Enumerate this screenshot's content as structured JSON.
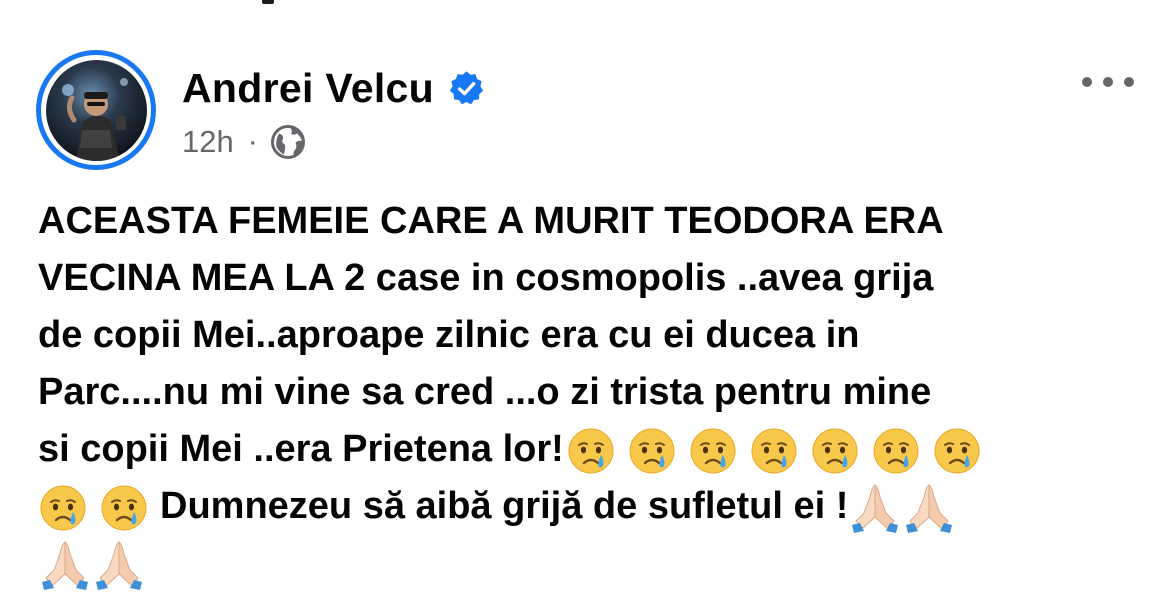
{
  "post": {
    "author": {
      "name": "Andrei Velcu",
      "verified_icon": "verified-badge-icon",
      "avatar_icon": "profile-photo"
    },
    "meta": {
      "time": "12h",
      "separator": "·",
      "audience_icon": "globe-public-icon"
    },
    "more_icon": "more-options-icon",
    "body": {
      "lines": [
        "ACEASTA FEMEIE CARE A MURIT TEODORA ERA",
        "VECINA MEA LA 2 case in cosmopolis ..avea grija",
        "de copii Mei..aproape zilnic era cu ei ducea in",
        "Parc....nu mi vine sa cred ...o zi trista pentru mine",
        "si copii Mei ..era Prietena lor!",
        "Dumnezeu să aibă grijă de sufletul ei !"
      ],
      "emojis": {
        "crying_face_count_line5": 7,
        "crying_face_count_line6": 2,
        "praying_hands_count_line6": 2,
        "praying_hands_count_line7": 2,
        "crying_face_icon": "crying-face-emoji",
        "praying_hands_icon": "folded-hands-emoji"
      }
    }
  },
  "colors": {
    "accent": "#1877f2",
    "text": "#050505",
    "secondary_text": "#65676b"
  }
}
